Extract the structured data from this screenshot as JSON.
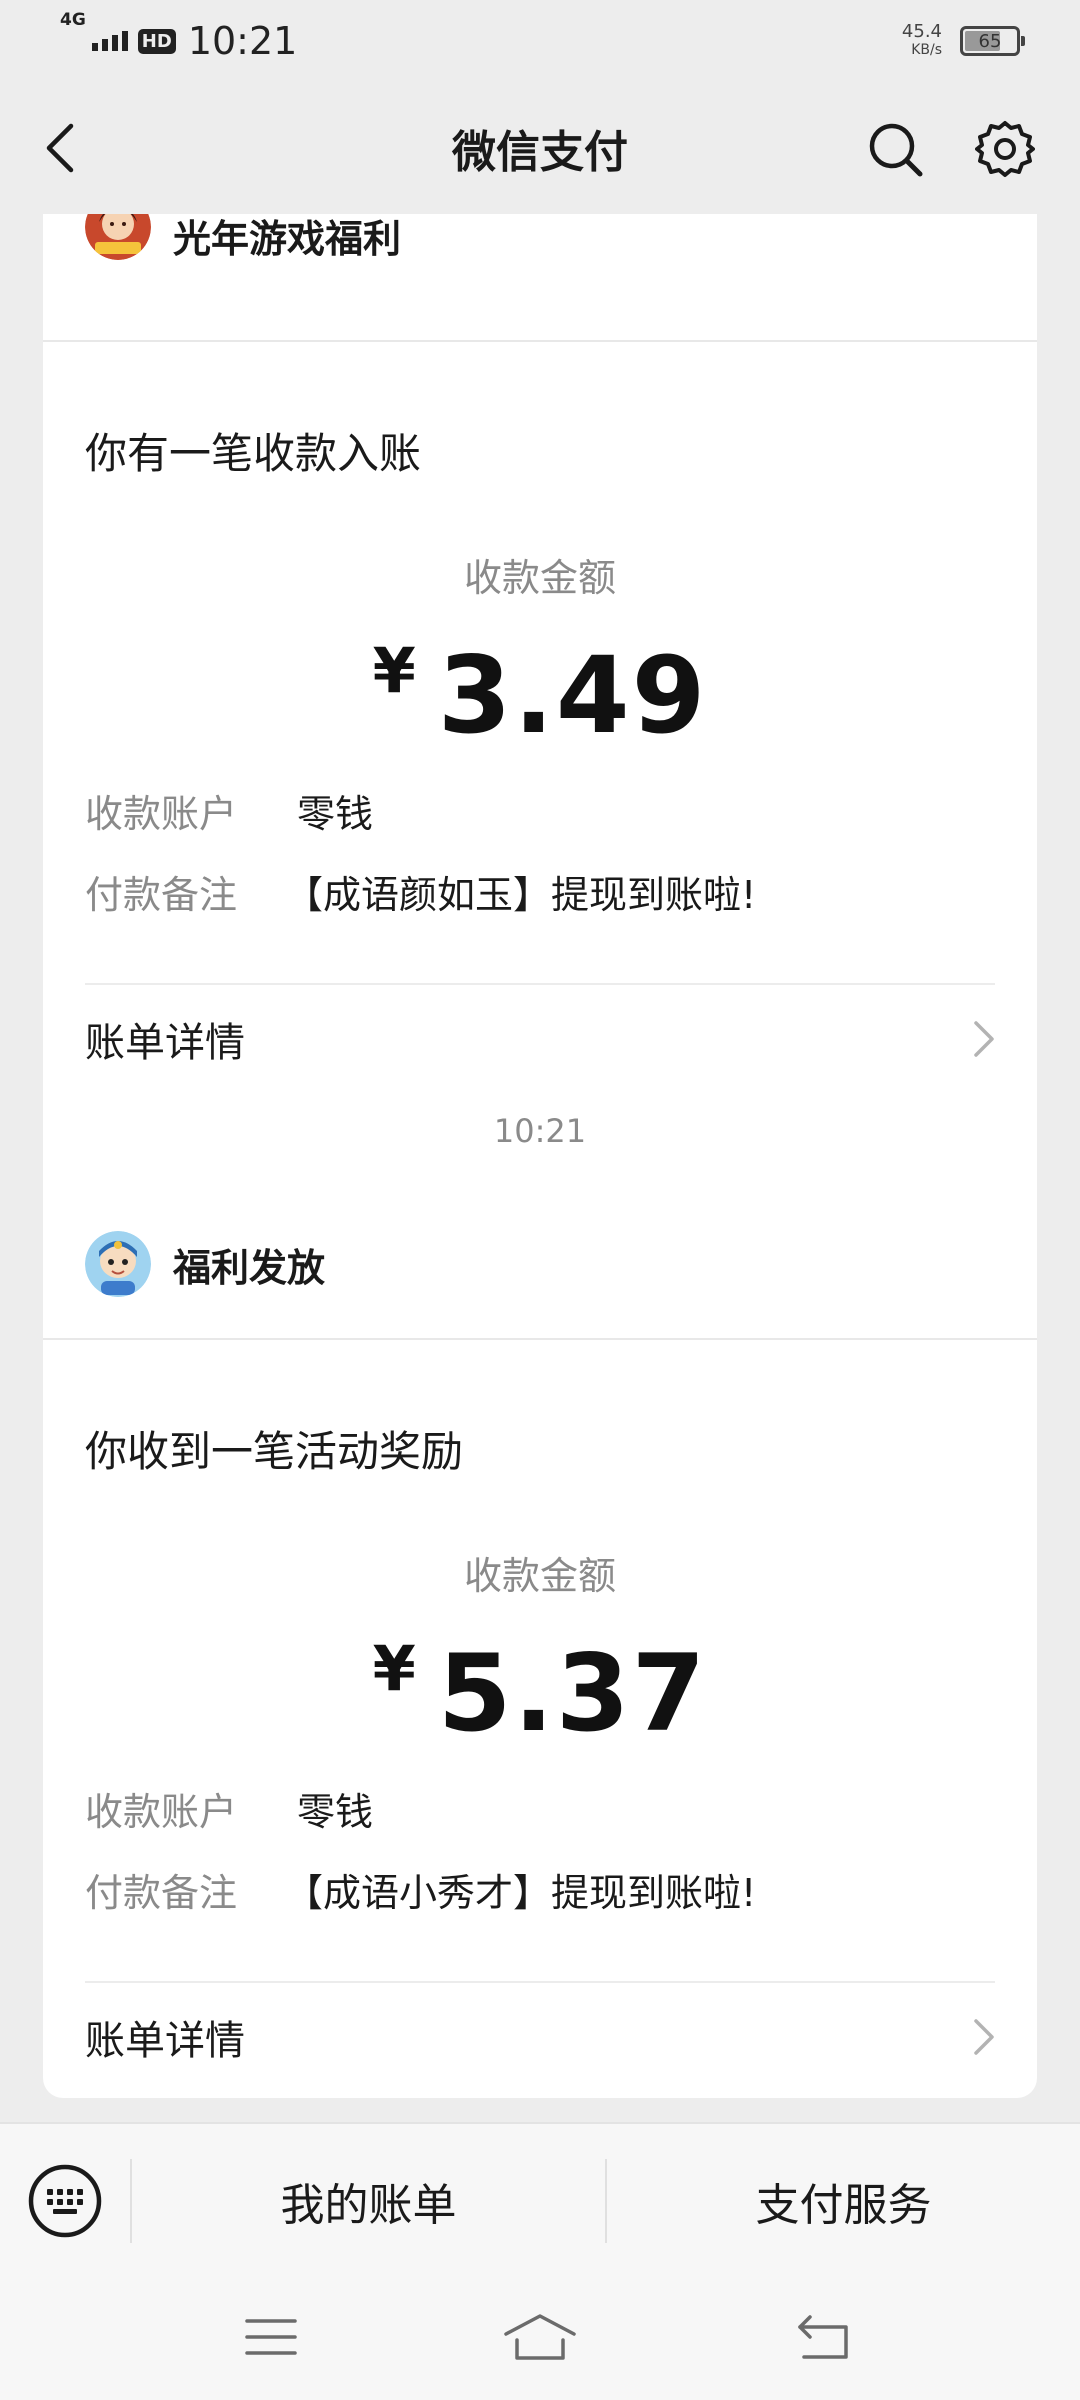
{
  "status_bar": {
    "network": "4G",
    "hd_badge": "HD",
    "time": "10:21",
    "speed_value": "45.4",
    "speed_unit": "KB/s",
    "battery_level": "65"
  },
  "nav": {
    "title": "微信支付",
    "back_icon": "chevron-left-icon",
    "search_icon": "search-icon",
    "settings_icon": "gear-icon"
  },
  "messages": [
    {
      "sender": "光年游戏福利",
      "avatar_icon": "game-character-avatar",
      "title": "你有一笔收款入账",
      "amount_label": "收款金额",
      "currency": "¥",
      "amount": "3.49",
      "account_label": "收款账户",
      "account_value": "零钱",
      "memo_label": "付款备注",
      "memo_value": "【成语颜如玉】提现到账啦!",
      "detail_label": "账单详情"
    },
    {
      "time": "10:21",
      "sender": "福利发放",
      "avatar_icon": "cartoon-boy-avatar",
      "title": "你收到一笔活动奖励",
      "amount_label": "收款金额",
      "currency": "¥",
      "amount": "5.37",
      "account_label": "收款账户",
      "account_value": "零钱",
      "memo_label": "付款备注",
      "memo_value": "【成语小秀才】提现到账啦!",
      "detail_label": "账单详情"
    }
  ],
  "bottom_bar": {
    "keyboard_icon": "keyboard-icon",
    "menu_1": "我的账单",
    "menu_2": "支付服务"
  },
  "system_nav": {
    "menu_icon": "menu-lines-icon",
    "home_icon": "home-icon",
    "back_icon": "back-arrow-icon"
  },
  "colors": {
    "background": "#ededed",
    "card": "#ffffff",
    "secondary_text": "#8a8a8a",
    "primary_text": "#1a1a1a"
  }
}
